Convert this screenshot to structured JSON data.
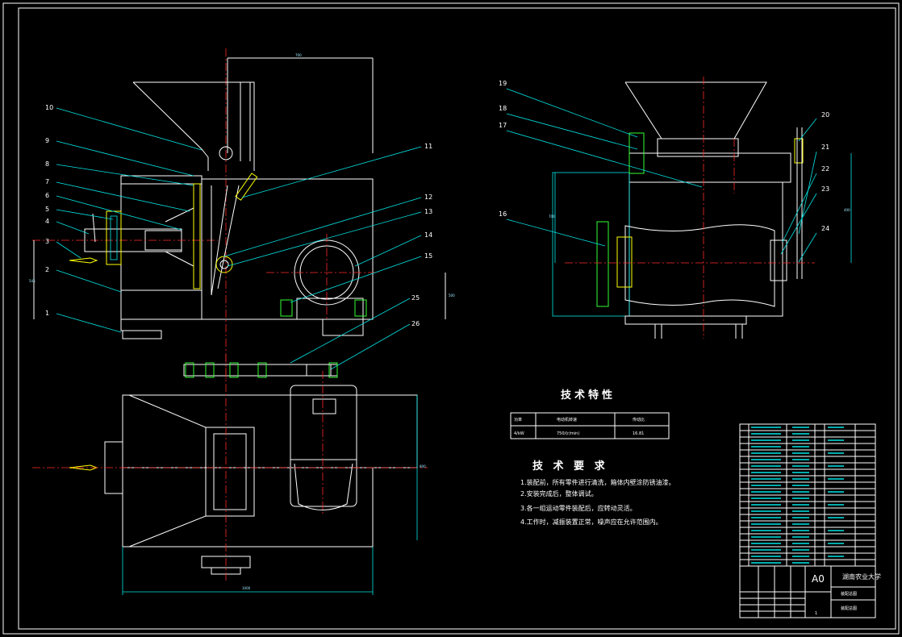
{
  "drawing": {
    "background": "#000000",
    "line_colors": {
      "outline": "#ffffff",
      "leader": "#00e5e5",
      "centerline": "#ff2a2a",
      "hatch": "#ffff00",
      "accent": "#33ff33"
    },
    "part_numbers_left": [
      "10",
      "9",
      "8",
      "7",
      "6",
      "5",
      "4",
      "3",
      "2",
      "1"
    ],
    "part_numbers_mid": [
      "11",
      "12",
      "13",
      "14",
      "15",
      "25",
      "26"
    ],
    "part_numbers_right_left": [
      "19",
      "18",
      "17",
      "16"
    ],
    "part_numbers_right_right": [
      "20",
      "21",
      "22",
      "23",
      "24"
    ]
  },
  "tech_characteristics": {
    "title": "技术特性",
    "headers": [
      "功率",
      "电动机转速",
      "传动比"
    ],
    "row": [
      "4/kW",
      "750/(r/min)",
      "16.81"
    ]
  },
  "tech_requirements": {
    "title": "技 术 要 求",
    "items": [
      "1.装配前，所有零件进行清洗，箱体内壁涂防锈油漆。",
      "2.安装完成后，整体调试。",
      "3.各一组运动零件装配后，应转动灵活。",
      "4.工作时，减振装置正常，噪声应在允许范围内。"
    ]
  },
  "title_block": {
    "scale_code": "A0",
    "school": "湖南农业大学",
    "drawing_name": "装配总图",
    "sheet": "1"
  }
}
